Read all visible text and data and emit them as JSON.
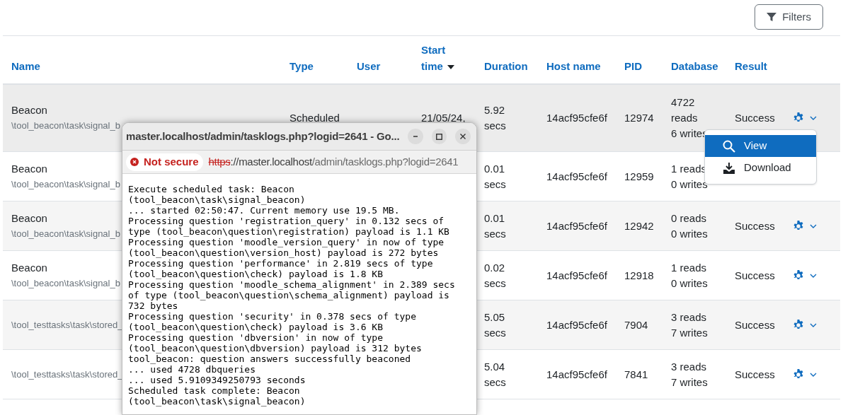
{
  "filters_button": "Filters",
  "table": {
    "columns": [
      {
        "label": "Name",
        "sorted": false
      },
      {
        "label": "Type",
        "sorted": false
      },
      {
        "label": "User",
        "sorted": false
      },
      {
        "label": "Start time",
        "sorted": true
      },
      {
        "label": "Duration",
        "sorted": false
      },
      {
        "label": "Host name",
        "sorted": false
      },
      {
        "label": "PID",
        "sorted": false
      },
      {
        "label": "Database",
        "sorted": false
      },
      {
        "label": "Result",
        "sorted": false
      }
    ],
    "rows": [
      {
        "name": "Beacon",
        "classname": "\\tool_beacon\\task\\signal_b",
        "type": "Scheduled",
        "start_time": "21/05/24,",
        "duration": [
          "5.92",
          "secs"
        ],
        "host": "14acf95cfe6f",
        "pid": "12974",
        "database": [
          "4722",
          "reads",
          "6 writes"
        ],
        "result": "Success"
      },
      {
        "name": "Beacon",
        "classname": "\\tool_beacon\\task\\signal_b",
        "duration": [
          "0.01",
          "secs"
        ],
        "host": "14acf95cfe6f",
        "pid": "12959",
        "database": [
          "1 reads",
          "0 writes"
        ]
      },
      {
        "name": "Beacon",
        "classname": "\\tool_beacon\\task\\signal_b",
        "duration": [
          "0.01",
          "secs"
        ],
        "host": "14acf95cfe6f",
        "pid": "12942",
        "database": [
          "0 reads",
          "0 writes"
        ],
        "result": "Success"
      },
      {
        "name": "Beacon",
        "classname": "\\tool_beacon\\task\\signal_b",
        "duration": [
          "0.02",
          "secs"
        ],
        "host": "14acf95cfe6f",
        "pid": "12918",
        "database": [
          "1 reads",
          "0 writes"
        ],
        "result": "Success"
      },
      {
        "classname": "\\tool_testtasks\\task\\stored_",
        "duration": [
          "5.05",
          "secs"
        ],
        "host": "14acf95cfe6f",
        "pid": "7904",
        "database": [
          "3 reads",
          "7 writes"
        ],
        "result": "Success"
      },
      {
        "classname": "\\tool_testtasks\\task\\stored_",
        "duration": [
          "5.04",
          "secs"
        ],
        "host": "14acf95cfe6f",
        "pid": "7841",
        "database": [
          "3 reads",
          "7 writes"
        ],
        "result": "Success"
      }
    ]
  },
  "action_menu": {
    "items": [
      {
        "label": "View",
        "kind": "view",
        "selected": true
      },
      {
        "label": "Download",
        "kind": "download",
        "selected": false
      }
    ]
  },
  "popup": {
    "title": "master.localhost/admin/tasklogs.php?logid=2641 - Go...",
    "security": "Not secure",
    "url": {
      "scheme": "https",
      "host": "://master.localhost",
      "path": "/admin/tasklogs.php?logid=2641"
    },
    "log": [
      "Execute scheduled task: Beacon",
      "(tool_beacon\\task\\signal_beacon)",
      "... started 02:50:47. Current memory use 19.5 MB.",
      "Processing question 'registration_query' in 0.132 secs of",
      "type (tool_beacon\\question\\registration) payload is 1.1 KB",
      "Processing question 'moodle_version_query' in now of type",
      "(tool_beacon\\question\\version_host) payload is 272 bytes",
      "Processing question 'performance' in 2.819 secs of type",
      "(tool_beacon\\question\\check) payload is 1.8 KB",
      "Processing question 'moodle_schema_alignment' in 2.389 secs",
      "of type (tool_beacon\\question\\schema_alignment) payload is",
      "732 bytes",
      "Processing question 'security' in 0.378 secs of type",
      "(tool_beacon\\question\\check) payload is 3.6 KB",
      "Processing question 'dbversion' in now of type",
      "(tool_beacon\\question\\dbversion) payload is 312 bytes",
      "tool_beacon: question answers successfully beaconed",
      "... used 4728 dbqueries",
      "... used 5.9109349250793 seconds",
      "Scheduled task complete: Beacon",
      "(tool_beacon\\task\\signal_beacon)"
    ]
  }
}
